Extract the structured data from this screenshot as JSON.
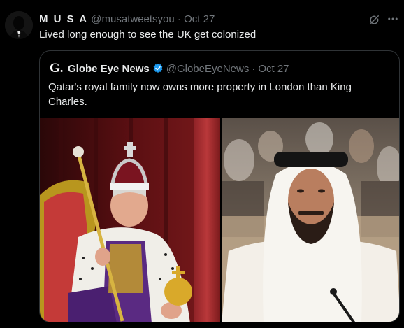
{
  "tweet": {
    "display_name": "M U S A",
    "handle": "@musatweetsyou",
    "separator": "·",
    "date": "Oct 27",
    "text": "Lived long enough to see the UK get colonized"
  },
  "icons": {
    "grok": "grok-icon",
    "more": "more-icon",
    "verified": "verified-icon"
  },
  "quote": {
    "logo": "G.",
    "display_name": "Globe Eye News",
    "handle": "@GlobeEyeNews",
    "separator": "·",
    "date": "Oct 27",
    "text": "Qatar's royal family now owns more property in London than King Charles."
  },
  "colors": {
    "background": "#000000",
    "text": "#e7e9ea",
    "muted": "#71767b",
    "verified": "#1d9bf0",
    "border": "#2f3336"
  }
}
